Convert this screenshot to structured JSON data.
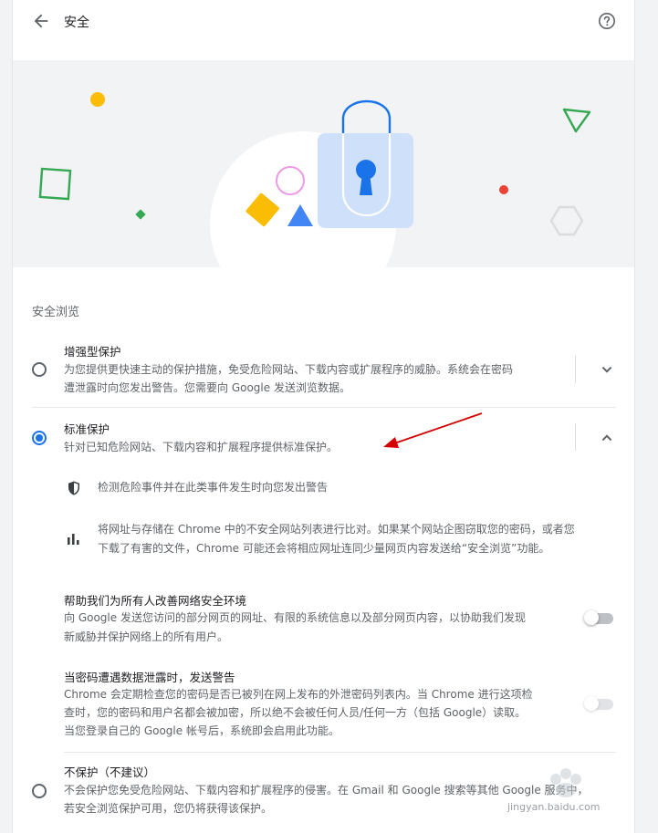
{
  "header": {
    "title": "安全",
    "back_icon": "arrow-back-icon",
    "help_icon": "help-icon"
  },
  "safe_browsing": {
    "heading": "安全浏览",
    "options": [
      {
        "title": "增强型保护",
        "description_lines": [
          "为您提供更快速主动的保护措施，免受危险网站、下载内容或扩展程序的威胁。系统会在密码",
          "遭泄露时向您发出警告。您需要向 Google 发送浏览数据。"
        ],
        "selected": false,
        "expanded": false
      },
      {
        "title": "标准保护",
        "description_lines": [
          "针对已知危险网站、下载内容和扩展程序提供标准保护。"
        ],
        "selected": true,
        "expanded": true
      },
      {
        "title": "不保护（不建议）",
        "description_lines": [
          "不会保护您免受危险网站、下载内容和扩展程序的侵害。在 Gmail 和 Google 搜索等其他 Google 服务中，",
          "若安全浏览保护可用，您仍将获得该保护。"
        ],
        "selected": false
      }
    ]
  },
  "standard_details": {
    "bullets": [
      {
        "icon": "shield-icon",
        "lines": [
          "检测危险事件并在此类事件发生时向您发出警告"
        ]
      },
      {
        "icon": "bar-chart-icon",
        "lines": [
          "将网址与存储在 Chrome 中的不安全网站列表进行比对。如果某个网站企图窃取您的密码，或者您",
          "下载了有害的文件，Chrome 可能还会将相应网址连同少量网页内容发送给“安全浏览”功能。"
        ]
      }
    ],
    "toggles": [
      {
        "title": "帮助我们为所有人改善网络安全环境",
        "lines": [
          "向 Google 发送您访问的部分网页的网址、有限的系统信息以及部分网页内容，以协助我们发现",
          "新威胁并保护网络上的所有用户。"
        ],
        "enabled": false
      },
      {
        "title": "当密码遭遇数据泄露时，发送警告",
        "lines": [
          "Chrome 会定期检查您的密码是否已被列在网上发布的外泄密码列表内。当 Chrome 进行这项检",
          "查时，您的密码和用户名都会被加密，所以绝不会被任何人员/任何一方（包括 Google）读取。",
          "当您登录自己的 Google 帐号后，系统即会启用此功能。"
        ],
        "enabled": false,
        "disabled_looking": true
      }
    ]
  },
  "watermark": {
    "text": "jingyan.baidu.com"
  },
  "colors": {
    "accent": "#1a73e8",
    "annotation_arrow": "#d50000"
  }
}
